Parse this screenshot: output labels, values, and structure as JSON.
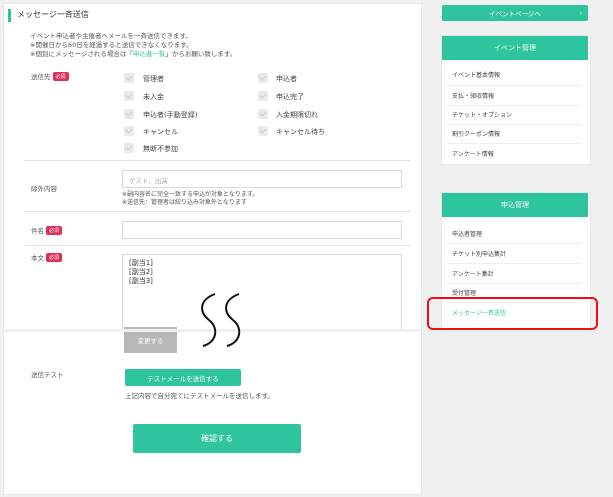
{
  "page": {
    "title": "メッセージ一斉送信",
    "description": {
      "line1": "イベント申込者や主催者へメールを一斉送信できます。",
      "line2": "※開催日から60日を経過すると送信できなくなります。",
      "line3_prefix": "※個別にメッセージされる場合は「",
      "line3_link": "申込者一覧",
      "line3_suffix": "」からお願い致します。"
    }
  },
  "form": {
    "recipients": {
      "label": "送信先",
      "required_badge": "必須",
      "options": [
        {
          "label": "管理者",
          "checked": true
        },
        {
          "label": "申込者",
          "checked": true
        },
        {
          "label": "未入金",
          "checked": true
        },
        {
          "label": "申込完了",
          "checked": true
        },
        {
          "label": "申込者(手動登録)",
          "checked": true
        },
        {
          "label": "入金期限切れ",
          "checked": true
        },
        {
          "label": "キャンセル",
          "checked": true
        },
        {
          "label": "キャンセル待ち",
          "checked": true
        },
        {
          "label": "無断不参加",
          "checked": true
        }
      ]
    },
    "exclude": {
      "label": "除外内容",
      "placeholder": "ゲスト、出演",
      "note1": "※副内容名に完全一致する申込が対象となります。",
      "note2": "※送信先：管理者は絞り込み対象外となります"
    },
    "subject": {
      "label": "件名",
      "required_badge": "必須",
      "value": ""
    },
    "body": {
      "label": "本文",
      "required_badge": "必須",
      "lines": [
        "[副当1]",
        "[副当2]",
        "[副当3]"
      ],
      "change_button": "変更する"
    },
    "test": {
      "label": "送信テスト",
      "button": "テストメールを送信する",
      "note": "上記内容で自分宛てにテストメールを送信します。"
    },
    "confirm_button": "確認する"
  },
  "sidebar": {
    "event_page_button": "イベントページへ",
    "event_page_arrow": "›",
    "event_admin": {
      "title": "イベント管理",
      "items": [
        "イベント基本情報",
        "支払・領収情報",
        "チケット・オプション",
        "割引クーポン情報",
        "アンケート情報"
      ]
    },
    "applicant_admin": {
      "title": "申込管理",
      "items": [
        "申込者管理",
        "チケット別申込集計",
        "アンケート集計",
        "受付管理",
        "メッセージ一斉送信"
      ]
    }
  },
  "colors": {
    "accent": "#2ec4a0",
    "required": "#e0305a",
    "highlight": "#e11111"
  }
}
